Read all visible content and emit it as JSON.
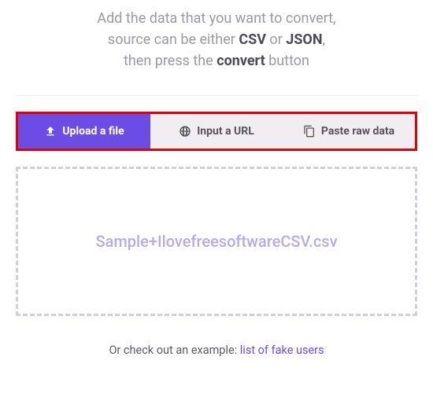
{
  "instruction": {
    "line1_pre": "Add the data that you want to convert,",
    "line2_pre": "source can be either ",
    "line2_b1": "CSV",
    "line2_mid": " or ",
    "line2_b2": "JSON",
    "line2_post": ",",
    "line3_pre": "then press the ",
    "line3_b": "convert",
    "line3_post": " button"
  },
  "tabs": {
    "upload": "Upload a file",
    "url": "Input a URL",
    "paste": "Paste raw data"
  },
  "dropzone": {
    "filename": "Sample+IlovefreesoftwareCSV.csv"
  },
  "example": {
    "pre": "Or check out an example: ",
    "link": "list of fake users"
  },
  "colors": {
    "accent": "#6b4de6",
    "highlight_border": "#e60000"
  }
}
